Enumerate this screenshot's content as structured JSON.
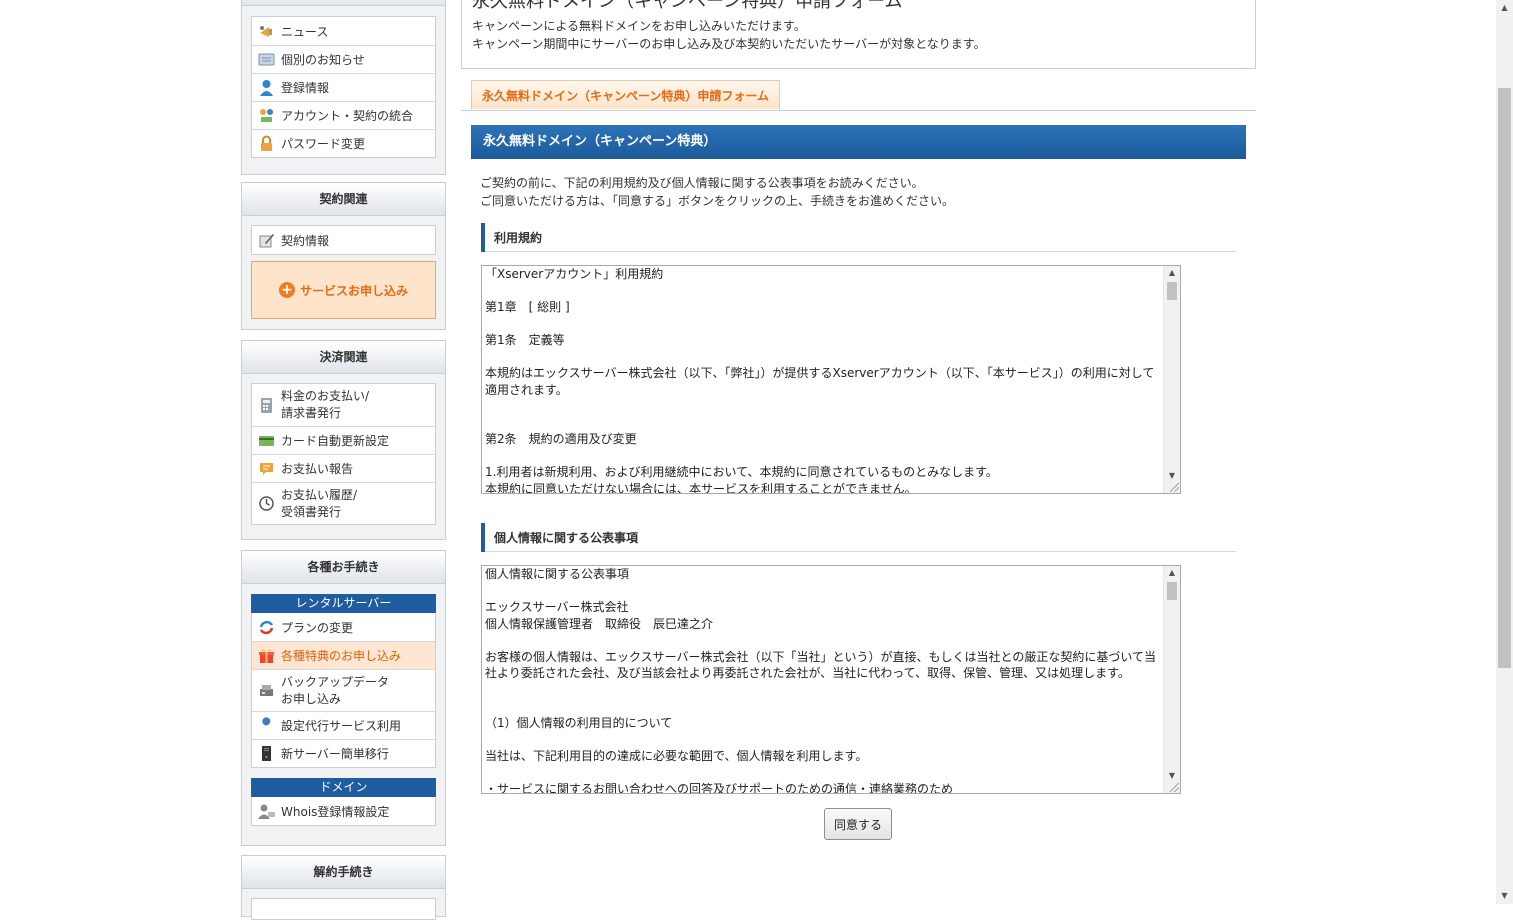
{
  "sidebar": {
    "account_items": [
      {
        "label": "ニュース",
        "icon": "news-megaphone-icon"
      },
      {
        "label": "個別のお知らせ",
        "icon": "message-icon"
      },
      {
        "label": "登録情報",
        "icon": "user-icon"
      },
      {
        "label": "アカウント・契約の統合",
        "icon": "merge-icon"
      },
      {
        "label": "パスワード変更",
        "icon": "lock-icon"
      }
    ],
    "contract": {
      "title": "契約関連",
      "items": [
        {
          "label": "契約情報",
          "icon": "contract-pen-icon"
        }
      ],
      "apply_button": "サービスお申し込み"
    },
    "payment": {
      "title": "決済関連",
      "items": [
        {
          "line1": "料金のお支払い/",
          "line2": "請求書発行",
          "icon": "calculator-icon"
        },
        {
          "label": "カード自動更新設定",
          "icon": "credit-card-icon"
        },
        {
          "label": "お支払い報告",
          "icon": "report-icon"
        },
        {
          "line1": "お支払い履歴/",
          "line2": "受領書発行",
          "icon": "clock-icon"
        }
      ]
    },
    "procedures": {
      "title": "各種お手続き",
      "rental_header": "レンタルサーバー",
      "rental_items": [
        {
          "label": "プランの変更",
          "icon": "plan-change-icon"
        },
        {
          "label": "各種特典のお申し込み",
          "icon": "gift-icon"
        },
        {
          "line1": "バックアップデータ",
          "line2": "お申し込み",
          "icon": "backup-icon"
        },
        {
          "label": "設定代行サービス利用",
          "icon": "wrench-icon"
        },
        {
          "label": "新サーバー簡単移行",
          "icon": "server-icon"
        }
      ],
      "domain_header": "ドメイン",
      "domain_items": [
        {
          "label": "Whois登録情報設定",
          "icon": "whois-user-icon"
        }
      ]
    },
    "cancel": {
      "title": "解約手続き"
    }
  },
  "main": {
    "page_title": "永久無料ドメイン（キャンペーン特典）申請フォーム",
    "intro_lines": [
      "キャンペーンによる無料ドメインをお申し込みいただけます。",
      "キャンペーン期間中にサーバーのお申し込み及び本契約いただいたサーバーが対象となります。"
    ],
    "tab_label": "永久無料ドメイン（キャンペーン特典）申請フォーム",
    "section_title": "永久無料ドメイン（キャンペーン特典）",
    "desc_lines": [
      "ご契約の前に、下記の利用規約及び個人情報に関する公表事項をお読みください。",
      "ご同意いただける方は、「同意する」ボタンをクリックの上、手続きをお進めください。"
    ],
    "terms": {
      "heading": "利用規約",
      "lines": [
        "「Xserverアカウント」利用規約",
        "",
        "第1章　[ 総則 ]",
        "",
        "第1条　定義等",
        "",
        "本規約はエックスサーバー株式会社（以下、「弊社」）が提供するXserverアカウント（以下、「本サービス」）の利用に対して適用されます。",
        "",
        "",
        "第2条　規約の適用及び変更",
        "",
        "1.利用者は新規利用、および利用継続中において、本規約に同意されているものとみなします。",
        "本規約に同意いただけない場合には、本サービスを利用することができません。"
      ]
    },
    "privacy": {
      "heading": "個人情報に関する公表事項",
      "lines": [
        "個人情報に関する公表事項",
        "",
        "エックスサーバー株式会社",
        "個人情報保護管理者　取締役　辰巳達之介",
        "",
        "お客様の個人情報は、エックスサーバー株式会社（以下「当社」という）が直接、もしくは当社との厳正な契約に基づいて当社より委託された会社、及び当該会社より再委託された会社が、当社に代わって、取得、保管、管理、又は処理します。",
        "",
        "",
        "（1）個人情報の利用目的について",
        "",
        "当社は、下記利用目的の達成に必要な範囲で、個人情報を利用します。",
        "",
        "・サービスに関するお問い合わせへの回答及びサポートのための通信・連絡業務のため"
      ]
    },
    "agree_button": "同意する"
  },
  "colors": {
    "accent_orange": "#e86a13",
    "nav_blue": "#1f5ca0"
  }
}
